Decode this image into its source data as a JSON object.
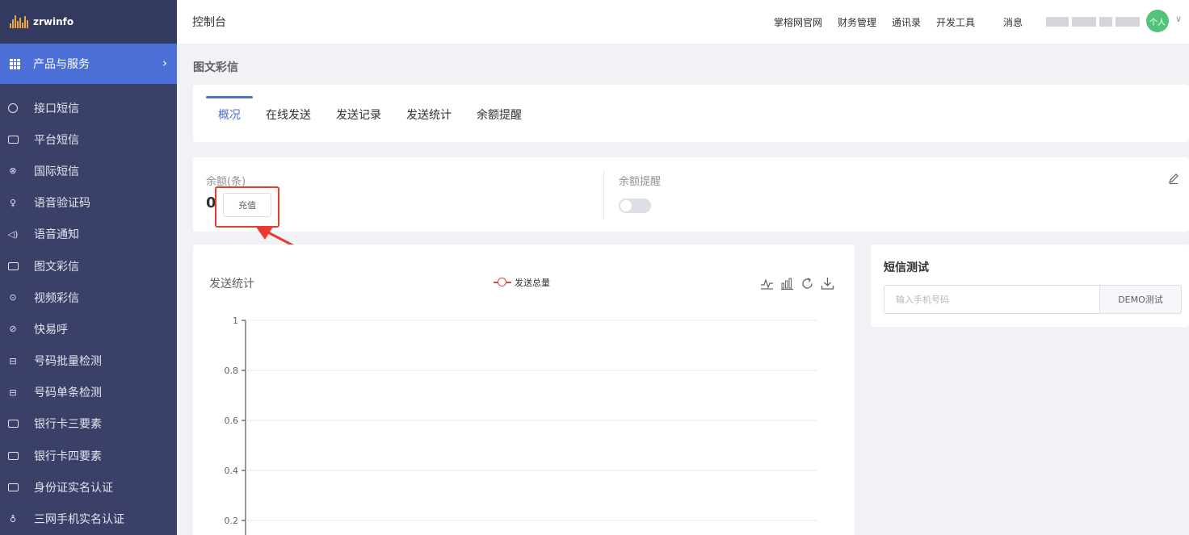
{
  "brand": {
    "name": "zrwinfo",
    "accent": "#4c6fd8",
    "sidebar_bg": "#3a4068"
  },
  "header": {
    "title": "控制台",
    "nav": [
      "掌榕网官网",
      "财务管理",
      "通讯录",
      "开发工具"
    ],
    "message": "消息",
    "avatar_label": "个人"
  },
  "sidebar": {
    "group": "产品与服务",
    "items": [
      {
        "label": "接口短信",
        "icon": "message-circle-icon"
      },
      {
        "label": "平台短信",
        "icon": "chat-square-icon"
      },
      {
        "label": "国际短信",
        "icon": "globe-icon"
      },
      {
        "label": "语音验证码",
        "icon": "microphone-icon"
      },
      {
        "label": "语音通知",
        "icon": "speaker-icon"
      },
      {
        "label": "图文彩信",
        "icon": "image-icon"
      },
      {
        "label": "视频彩信",
        "icon": "play-circle-icon"
      },
      {
        "label": "快易呼",
        "icon": "compass-icon"
      },
      {
        "label": "号码批量检测",
        "icon": "scan-icon"
      },
      {
        "label": "号码单条检测",
        "icon": "scan-icon"
      },
      {
        "label": "银行卡三要素",
        "icon": "card-icon"
      },
      {
        "label": "银行卡四要素",
        "icon": "card-icon"
      },
      {
        "label": "身份证实名认证",
        "icon": "id-card-icon"
      },
      {
        "label": "三网手机实名认证",
        "icon": "user-icon"
      }
    ]
  },
  "page": {
    "title": "图文彩信"
  },
  "tabs": [
    "概况",
    "在线发送",
    "发送记录",
    "发送统计",
    "余额提醒"
  ],
  "balance": {
    "label": "余额(条)",
    "value": "0",
    "recharge_label": "充值",
    "alert_label": "余额提醒",
    "alert_enabled": false
  },
  "chart_data": {
    "type": "line",
    "title": "发送统计",
    "series": [
      {
        "name": "发送总量",
        "values": []
      }
    ],
    "y_ticks": [
      "1",
      "0.8",
      "0.6",
      "0.4",
      "0.2"
    ],
    "ylim": [
      0,
      1
    ],
    "grid": true,
    "legend": "top-center",
    "color": "#d94b4b"
  },
  "sms_test": {
    "title": "短信测试",
    "placeholder": "输入手机号码",
    "button_label": "DEMO测试"
  }
}
